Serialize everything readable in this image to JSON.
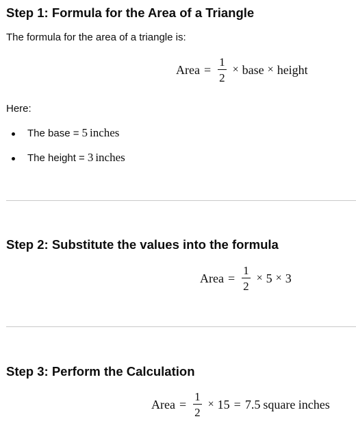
{
  "step1": {
    "heading": "Step 1: Formula for the Area of a Triangle",
    "intro": "The formula for the area of a triangle is:",
    "formula": {
      "lhs": "Area",
      "equals": "=",
      "frac_num": "1",
      "frac_den": "2",
      "times1": "×",
      "term1": "base",
      "times2": "×",
      "term2": "height"
    },
    "here_label": "Here:",
    "bullets": [
      {
        "label": "The base = ",
        "value": "5",
        "unit": "inches"
      },
      {
        "label": "The height = ",
        "value": "3",
        "unit": "inches"
      }
    ]
  },
  "step2": {
    "heading": "Step 2: Substitute the values into the formula",
    "formula": {
      "lhs": "Area",
      "equals": "=",
      "frac_num": "1",
      "frac_den": "2",
      "times1": "×",
      "term1": "5",
      "times2": "×",
      "term2": "3"
    }
  },
  "step3": {
    "heading": "Step 3: Perform the Calculation",
    "formula": {
      "lhs": "Area",
      "equals": "=",
      "frac_num": "1",
      "frac_den": "2",
      "times1": "×",
      "term1": "15",
      "equals2": "=",
      "result": "7.5",
      "unit": "square inches"
    }
  }
}
